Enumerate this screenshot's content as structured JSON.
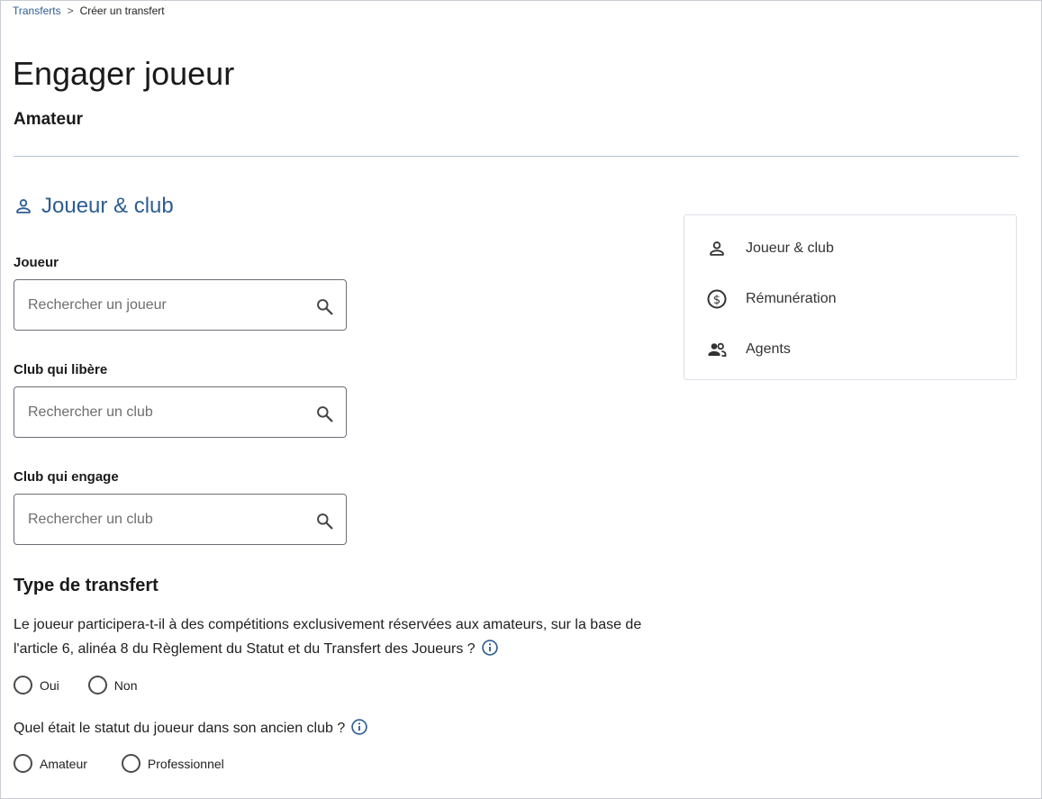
{
  "breadcrumb": {
    "parent": "Transferts",
    "separator": ">",
    "current": "Créer un transfert"
  },
  "page": {
    "title": "Engager joueur",
    "subtitle": "Amateur"
  },
  "section": {
    "title": "Joueur & club",
    "icon": "person-icon"
  },
  "fields": {
    "player": {
      "label": "Joueur",
      "placeholder": "Rechercher un joueur",
      "value": ""
    },
    "releasing_club": {
      "label": "Club qui libère",
      "placeholder": "Rechercher un club",
      "value": ""
    },
    "engaging_club": {
      "label": "Club qui engage",
      "placeholder": "Rechercher un club",
      "value": ""
    }
  },
  "transfer_type": {
    "heading": "Type de transfert",
    "q1": {
      "text": "Le joueur participera-t-il à des compétitions exclusivement réservées aux amateurs, sur la base de l'article 6, alinéa 8 du Règlement du Statut et du Transfert des Joueurs ?",
      "options": [
        "Oui",
        "Non"
      ]
    },
    "q2": {
      "text": "Quel était le statut du joueur dans son ancien club ?",
      "options": [
        "Amateur",
        "Professionnel"
      ]
    }
  },
  "side_nav": {
    "items": [
      {
        "label": "Joueur & club",
        "icon": "person-icon"
      },
      {
        "label": "Rémunération",
        "icon": "dollar-circle-icon"
      },
      {
        "label": "Agents",
        "icon": "people-icon"
      }
    ]
  },
  "colors": {
    "accent": "#2e5d93",
    "text": "#1a1a1a",
    "border": "#6b6f75",
    "divider": "#b8c2cf"
  }
}
